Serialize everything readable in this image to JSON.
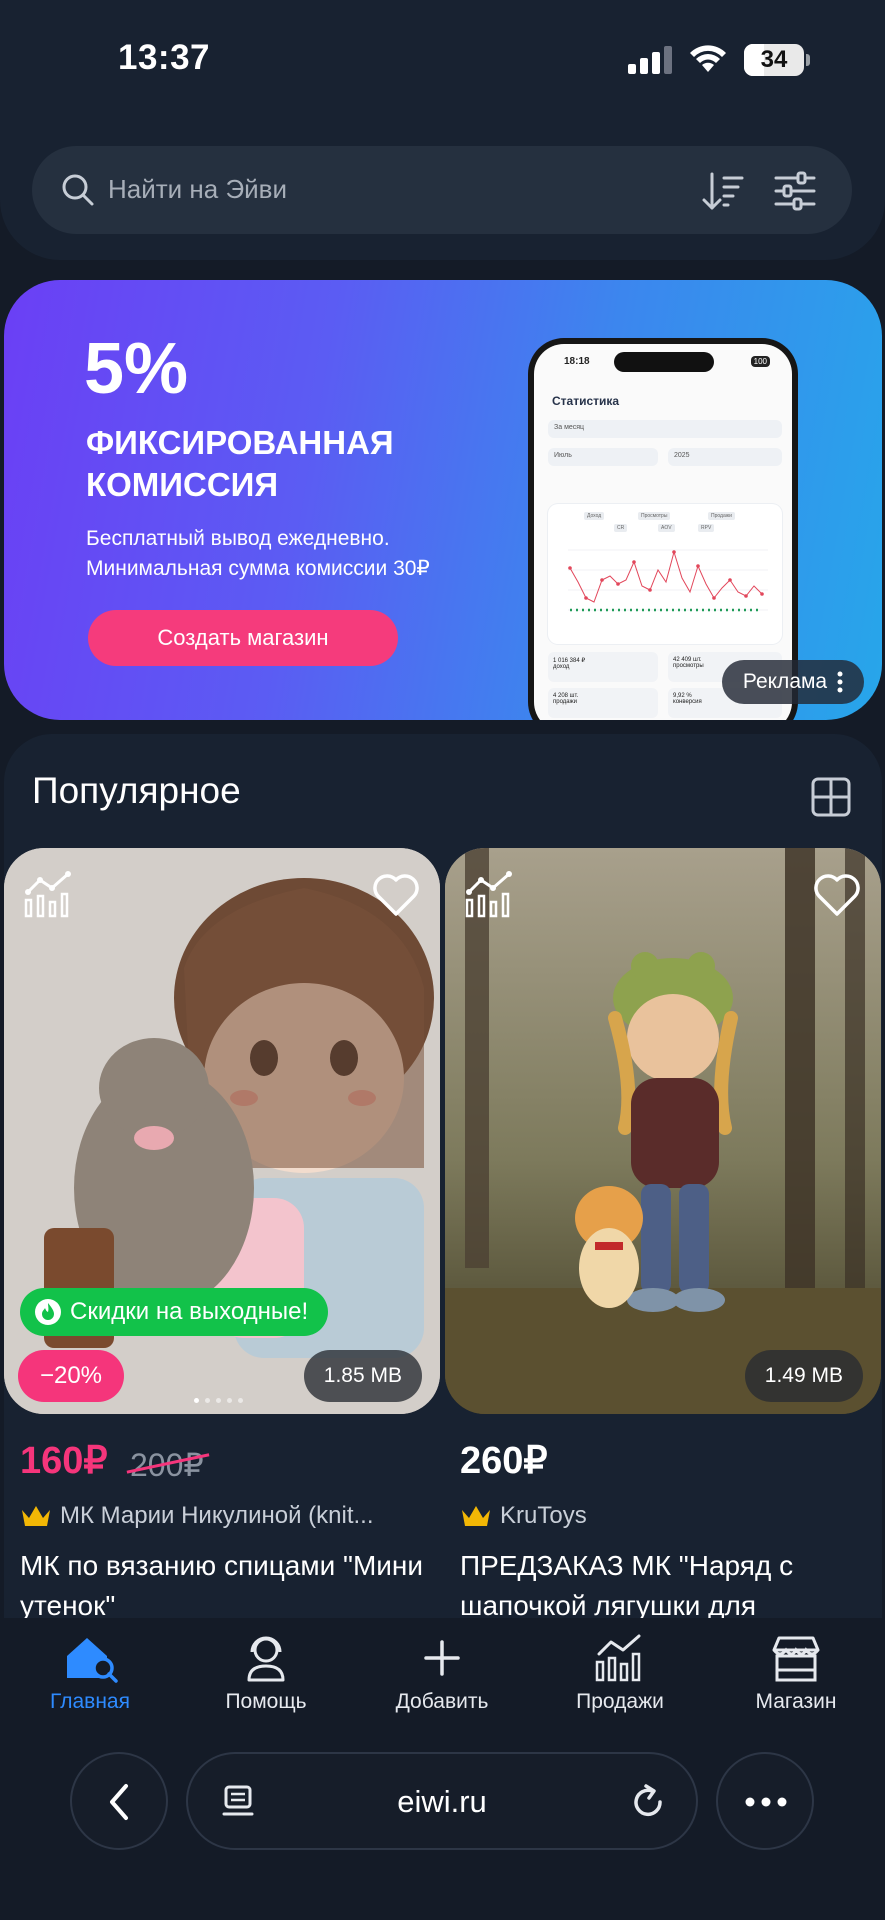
{
  "status_bar": {
    "time": "13:37",
    "battery": "34",
    "battery_level": 0.34
  },
  "search": {
    "placeholder": "Найти на Эйви"
  },
  "banner": {
    "percent": "5%",
    "title": "ФИКСИРОВАННАЯ КОМИССИЯ",
    "subtitle_line1": "Бесплатный вывод ежедневно.",
    "subtitle_line2": "Минимальная сумма комиссии 30₽",
    "cta": "Создать магазин",
    "ad_label": "Реклама",
    "phone": {
      "time": "18:18",
      "battery": "100",
      "title": "Статистика",
      "period": "За месяц",
      "month": "Июль",
      "year": "2025",
      "legend": [
        "Доход",
        "Просмотры",
        "Продажи",
        "CR",
        "AOV",
        "RPV"
      ],
      "stat1_value": "1 016 384 ₽",
      "stat1_label": "доход",
      "stat2_value": "42 409 шт.",
      "stat2_label": "просмотры",
      "stat3_value": "4 208 шт.",
      "stat3_label": "продажи",
      "stat4_value": "9,92 %",
      "stat4_label": "конверсия"
    }
  },
  "popular": {
    "title": "Популярное"
  },
  "products": [
    {
      "price": "160₽",
      "old_price": "200₽",
      "discount_tag": "Скидки на выходные!",
      "sale_badge": "−20%",
      "size": "1.85 MB",
      "seller": "МК Марии Никулиной (knit...",
      "title": "МК по вязанию спицами \"Мини утенок\""
    },
    {
      "price": "260₽",
      "size": "1.49 MB",
      "seller": "KruToys",
      "title": "ПРЕДЗАКАЗ МК \"Наряд с шапочкой лягушки для"
    }
  ],
  "nav": [
    {
      "label": "Главная",
      "icon": "home-search-icon",
      "active": true
    },
    {
      "label": "Помощь",
      "icon": "support-agent-icon"
    },
    {
      "label": "Добавить",
      "icon": "plus-icon"
    },
    {
      "label": "Продажи",
      "icon": "analytics-icon"
    },
    {
      "label": "Магазин",
      "icon": "store-icon"
    }
  ],
  "browser": {
    "url": "eiwi.ru"
  },
  "colors": {
    "accent_blue": "#2e8bff",
    "sale_pink": "#f5357b",
    "discount_green": "#12c24a",
    "background": "#141b27"
  }
}
